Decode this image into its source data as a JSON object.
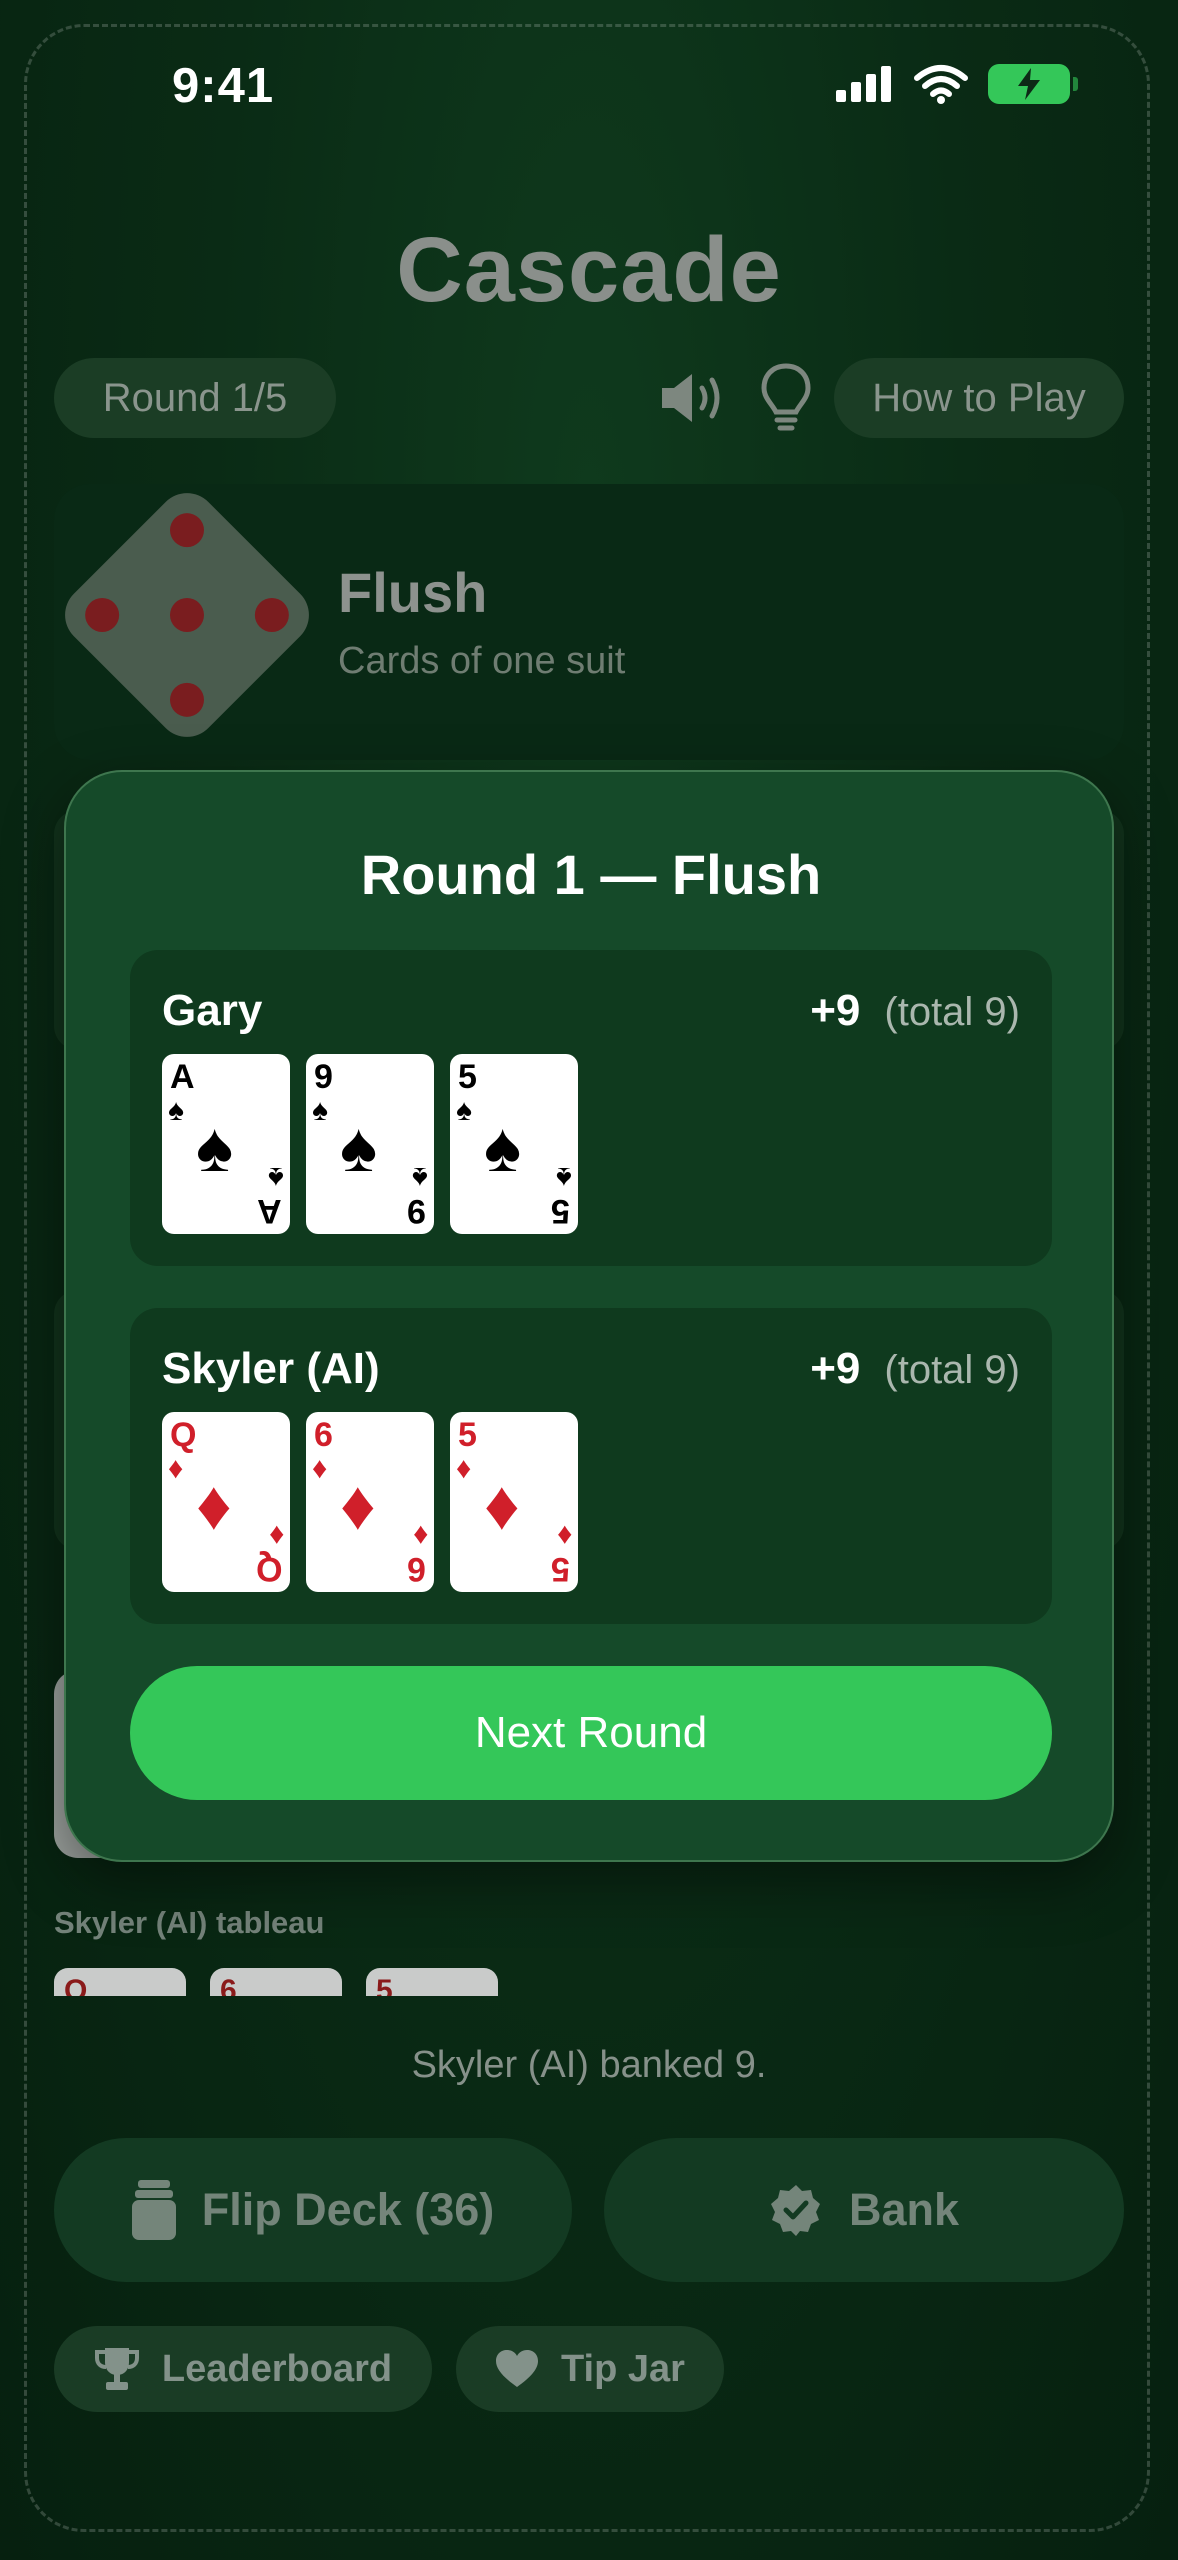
{
  "status_bar": {
    "time": "9:41"
  },
  "header": {
    "title": "Cascade",
    "round_label": "Round 1/5",
    "how_to_play_label": "How to Play"
  },
  "mode": {
    "name": "Flush",
    "description": "Cards of one suit"
  },
  "background": {
    "tableau_label": "Skyler (AI) tableau",
    "mini_cards": [
      "Q",
      "6",
      "5"
    ],
    "status_message": "Skyler (AI) banked 9.",
    "flip_deck_label": "Flip Deck (36)",
    "bank_label": "Bank",
    "leaderboard_label": "Leaderboard",
    "tip_jar_label": "Tip Jar"
  },
  "modal": {
    "title": "Round 1 — Flush",
    "players": [
      {
        "name": "Gary",
        "score": "+9",
        "total": "(total 9)",
        "cards": [
          {
            "rank": "A",
            "suit": "♠",
            "color": "#000000"
          },
          {
            "rank": "9",
            "suit": "♠",
            "color": "#000000"
          },
          {
            "rank": "5",
            "suit": "♠",
            "color": "#000000"
          }
        ]
      },
      {
        "name": "Skyler (AI)",
        "score": "+9",
        "total": "(total 9)",
        "cards": [
          {
            "rank": "Q",
            "suit": "♦",
            "color": "#d01f2a"
          },
          {
            "rank": "6",
            "suit": "♦",
            "color": "#d01f2a"
          },
          {
            "rank": "5",
            "suit": "♦",
            "color": "#d01f2a"
          }
        ]
      }
    ],
    "next_round_label": "Next Round"
  },
  "colors": {
    "accent": "#34c759",
    "modal_bg": "#154a29",
    "card_red": "#d01f2a"
  },
  "icons": [
    "signal-icon",
    "wifi-icon",
    "battery-charging-icon",
    "speaker-icon",
    "lightbulb-icon",
    "die-icon",
    "deck-icon",
    "checkmark-seal-icon",
    "trophy-icon",
    "heart-icon"
  ]
}
